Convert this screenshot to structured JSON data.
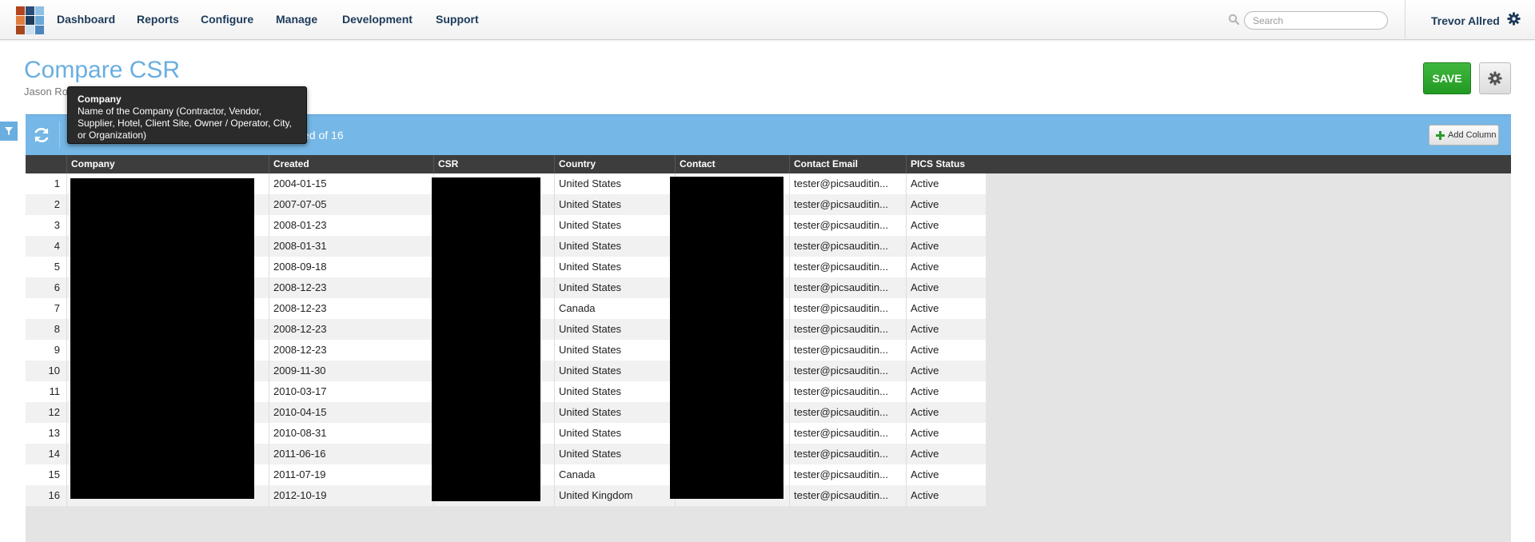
{
  "nav": {
    "items": [
      "Dashboard",
      "Reports",
      "Configure",
      "Manage",
      "Development",
      "Support"
    ],
    "search_placeholder": "Search",
    "user_name": "Trevor Allred"
  },
  "logo_colors": [
    "#b3451f",
    "#2b4f7a",
    "#8fbfe3",
    "#e07d3c",
    "#1f3b5c",
    "#6aa8d6",
    "#a8461c",
    "#c9dff0",
    "#4c86bd"
  ],
  "header": {
    "title": "Compare CSR",
    "subtitle": "Jason Ro"
  },
  "actions": {
    "save_label": "SAVE"
  },
  "tooltip": {
    "title": "Company",
    "body": "Name of the Company (Contractor, Vendor, Supplier, Hotel, Client Site, Owner / Operator, City, or Organization)"
  },
  "toolbar": {
    "displayed_text": "yed of 16",
    "add_column_label": "Add Column"
  },
  "table": {
    "columns": [
      "Company",
      "Created",
      "CSR",
      "Country",
      "Contact",
      "Contact Email",
      "PICS Status"
    ],
    "rows": [
      {
        "n": "1",
        "created": "2004-01-15",
        "country": "United States",
        "email": "tester@picsauditin...",
        "status": "Active"
      },
      {
        "n": "2",
        "created": "2007-07-05",
        "country": "United States",
        "email": "tester@picsauditin...",
        "status": "Active"
      },
      {
        "n": "3",
        "created": "2008-01-23",
        "country": "United States",
        "email": "tester@picsauditin...",
        "status": "Active"
      },
      {
        "n": "4",
        "created": "2008-01-31",
        "country": "United States",
        "email": "tester@picsauditin...",
        "status": "Active"
      },
      {
        "n": "5",
        "created": "2008-09-18",
        "country": "United States",
        "email": "tester@picsauditin...",
        "status": "Active"
      },
      {
        "n": "6",
        "created": "2008-12-23",
        "country": "United States",
        "email": "tester@picsauditin...",
        "status": "Active"
      },
      {
        "n": "7",
        "created": "2008-12-23",
        "country": "Canada",
        "email": "tester@picsauditin...",
        "status": "Active"
      },
      {
        "n": "8",
        "created": "2008-12-23",
        "country": "United States",
        "email": "tester@picsauditin...",
        "status": "Active"
      },
      {
        "n": "9",
        "created": "2008-12-23",
        "country": "United States",
        "email": "tester@picsauditin...",
        "status": "Active"
      },
      {
        "n": "10",
        "created": "2009-11-30",
        "country": "United States",
        "email": "tester@picsauditin...",
        "status": "Active"
      },
      {
        "n": "11",
        "created": "2010-03-17",
        "country": "United States",
        "email": "tester@picsauditin...",
        "status": "Active"
      },
      {
        "n": "12",
        "created": "2010-04-15",
        "country": "United States",
        "email": "tester@picsauditin...",
        "status": "Active"
      },
      {
        "n": "13",
        "created": "2010-08-31",
        "country": "United States",
        "email": "tester@picsauditin...",
        "status": "Active"
      },
      {
        "n": "14",
        "created": "2011-06-16",
        "country": "United States",
        "email": "tester@picsauditin...",
        "status": "Active"
      },
      {
        "n": "15",
        "created": "2011-07-19",
        "country": "Canada",
        "email": "tester@picsauditin...",
        "status": "Active"
      },
      {
        "n": "16",
        "created": "2012-10-19",
        "country": "United Kingdom",
        "email": "tester@picsauditin...",
        "status": "Active"
      }
    ]
  },
  "colors": {
    "accent": "#75b7e6",
    "title": "#6aaee0",
    "save": "#2aa52a",
    "header_bg": "#3d3d3d"
  }
}
